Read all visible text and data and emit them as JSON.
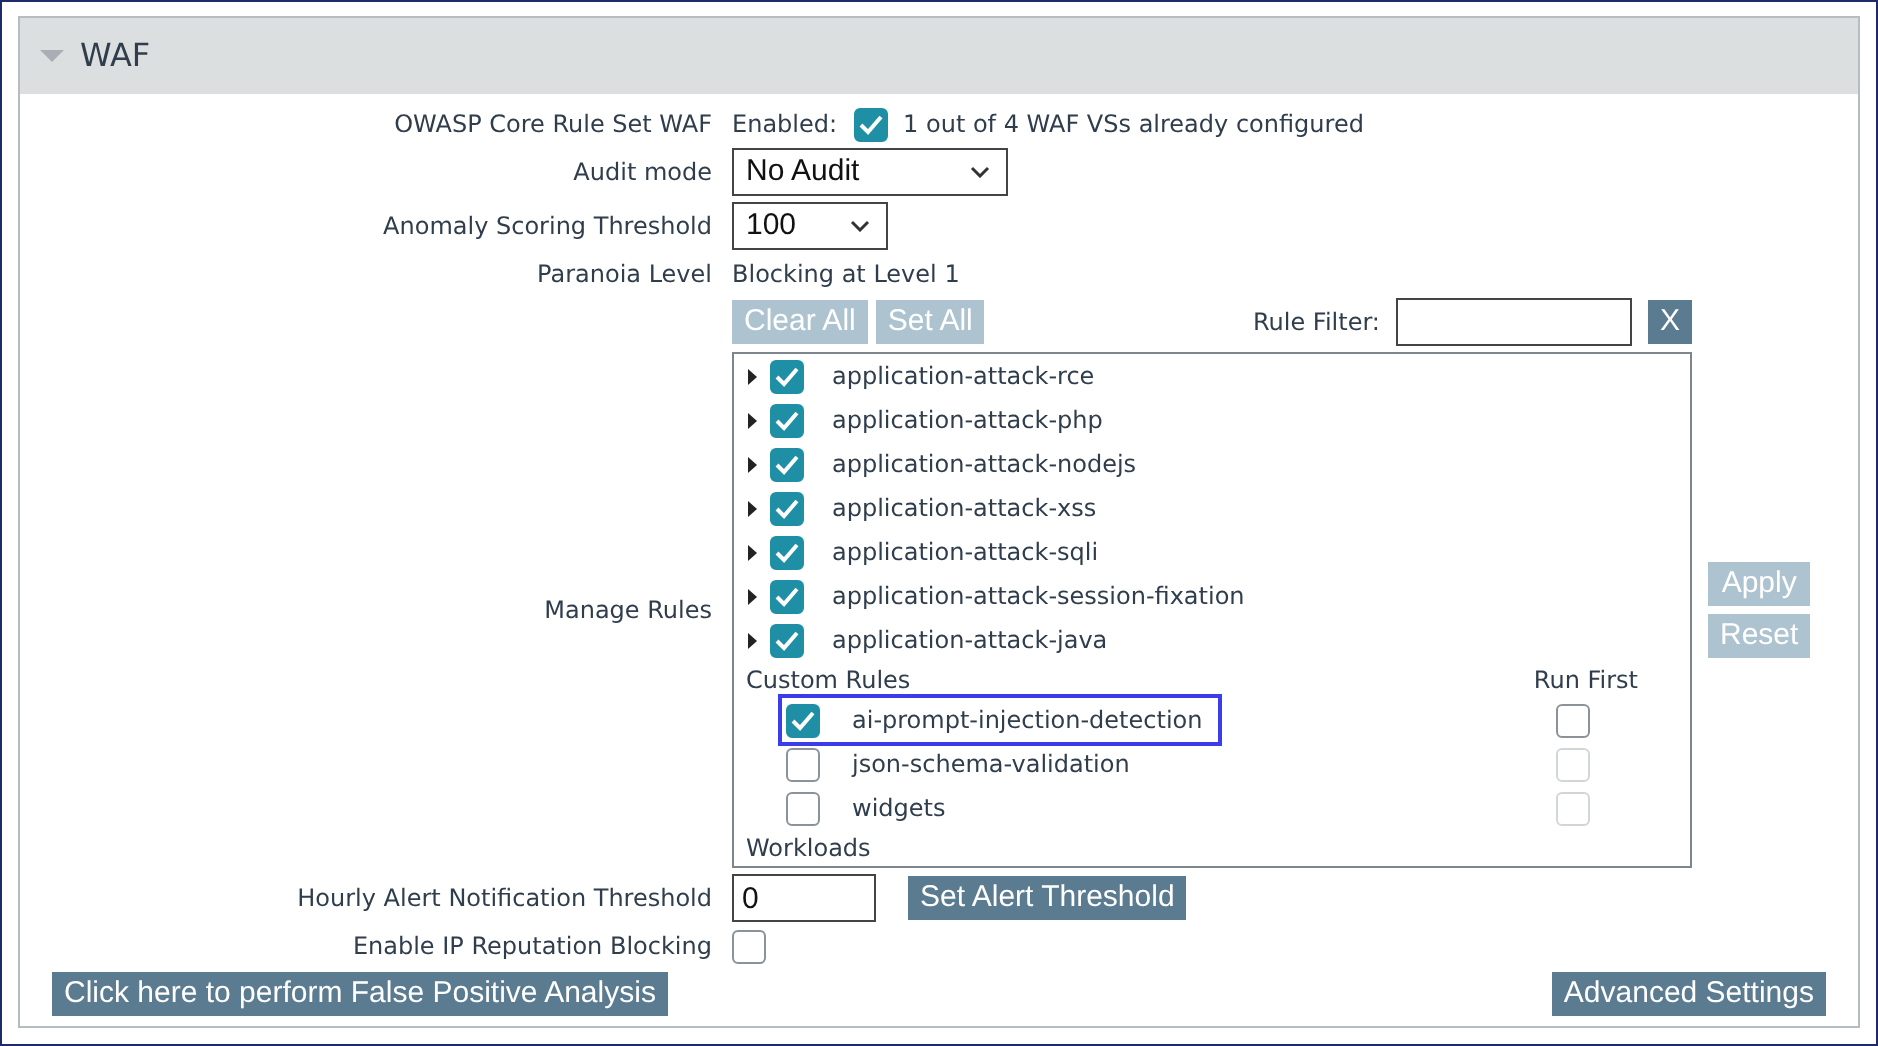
{
  "section": {
    "title": "WAF",
    "expanded": true
  },
  "owasp": {
    "label": "OWASP Core Rule Set WAF",
    "prefix": "Enabled:",
    "checked": true,
    "note": "1 out of 4 WAF VSs already configured"
  },
  "audit_mode": {
    "label": "Audit mode",
    "value": "No Audit"
  },
  "anomaly_threshold": {
    "label": "Anomaly Scoring Threshold",
    "value": "100"
  },
  "paranoia": {
    "label": "Paranoia Level",
    "value": "Blocking at Level 1"
  },
  "manage_rules": {
    "label": "Manage Rules",
    "buttons": [
      {
        "label": "Clear All",
        "disabled": true
      },
      {
        "label": "Set All",
        "disabled": true
      }
    ],
    "filter": {
      "label": "Rule Filter:",
      "clear": "X"
    },
    "rule_sets": [
      {
        "name": "application-attack-rce",
        "checked": true
      },
      {
        "name": "application-attack-php",
        "checked": true
      },
      {
        "name": "application-attack-nodejs",
        "checked": true
      },
      {
        "name": "application-attack-xss",
        "checked": true
      },
      {
        "name": "application-attack-sqli",
        "checked": true
      },
      {
        "name": "application-attack-session-fixation",
        "checked": true
      },
      {
        "name": "application-attack-java",
        "checked": true
      }
    ],
    "custom_heading": "Custom Rules",
    "run_first_heading": "Run First",
    "custom_rules": [
      {
        "name": "ai-prompt-injection-detection",
        "checked": true,
        "highlighted": true,
        "run_first": false,
        "run_first_disabled": false
      },
      {
        "name": "json-schema-validation",
        "checked": false,
        "highlighted": false,
        "run_first": false,
        "run_first_disabled": true
      },
      {
        "name": "widgets",
        "checked": false,
        "highlighted": false,
        "run_first": false,
        "run_first_disabled": true
      }
    ],
    "workloads_heading": "Workloads",
    "side_buttons": [
      {
        "label": "Apply",
        "disabled": true
      },
      {
        "label": "Reset",
        "disabled": true
      }
    ]
  },
  "alert_threshold": {
    "label": "Hourly Alert Notification Threshold",
    "value": "0",
    "button": "Set Alert Threshold"
  },
  "ip_reputation": {
    "label": "Enable IP Reputation Blocking",
    "checked": false
  },
  "footer_buttons": [
    "Click here to perform False Positive Analysis",
    "Advanced Settings"
  ]
}
